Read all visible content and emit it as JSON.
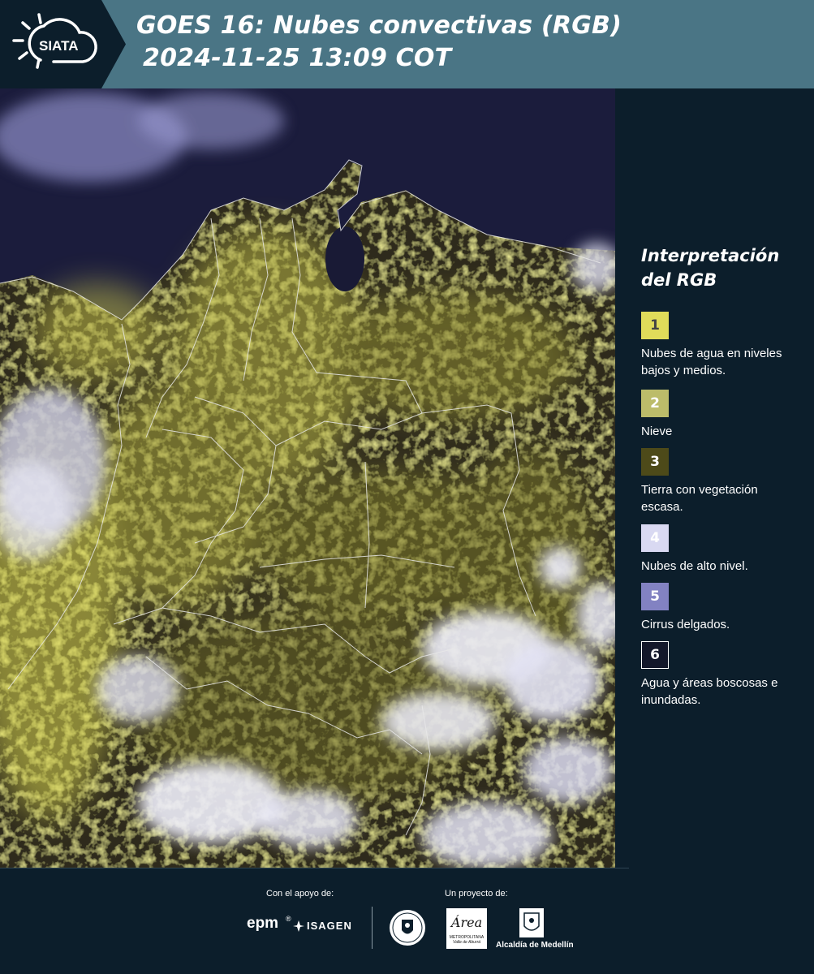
{
  "header": {
    "logo_text": "SIATA",
    "title_line1": "GOES 16: Nubes convectivas (RGB)",
    "title_line2": "2024-11-25 13:09 COT"
  },
  "legend": {
    "title_line1": "Interpretación",
    "title_line2": "del RGB",
    "items": [
      {
        "number": "1",
        "color": "#e0dc5a",
        "text_color": "#444444",
        "label": "Nubes de agua en niveles bajos y medios."
      },
      {
        "number": "2",
        "color": "#bcbc6a",
        "text_color": "#ffffff",
        "label": "Nieve"
      },
      {
        "number": "3",
        "color": "#4d4a19",
        "text_color": "#ffffff",
        "label": "Tierra con vegetación escasa."
      },
      {
        "number": "4",
        "color": "#d9d9f2",
        "text_color": "#ffffff",
        "label": "Nubes de alto nivel."
      },
      {
        "number": "5",
        "color": "#8282c2",
        "text_color": "#ffffff",
        "label": "Cirrus delgados."
      },
      {
        "number": "6",
        "color": "#13172a",
        "text_color": "#ffffff",
        "label": "Agua y áreas boscosas e inundadas."
      }
    ]
  },
  "footer": {
    "support_caption": "Con el apoyo de:",
    "project_caption": "Un proyecto de:",
    "sponsor_epm": "epm",
    "sponsor_isagen": "ISAGEN",
    "area_name": "Área",
    "area_sub1": "METROPOLITANA",
    "area_sub2": "Valle de Aburrá",
    "alcaldia": "Alcaldía de Medellín"
  },
  "colors": {
    "header_bg": "#4a7585",
    "panel_bg": "#0c1e2b",
    "ocean": "#1b1c3c",
    "land_low_cloud": "#c9c648",
    "high_cloud": "#e4e4f4"
  }
}
